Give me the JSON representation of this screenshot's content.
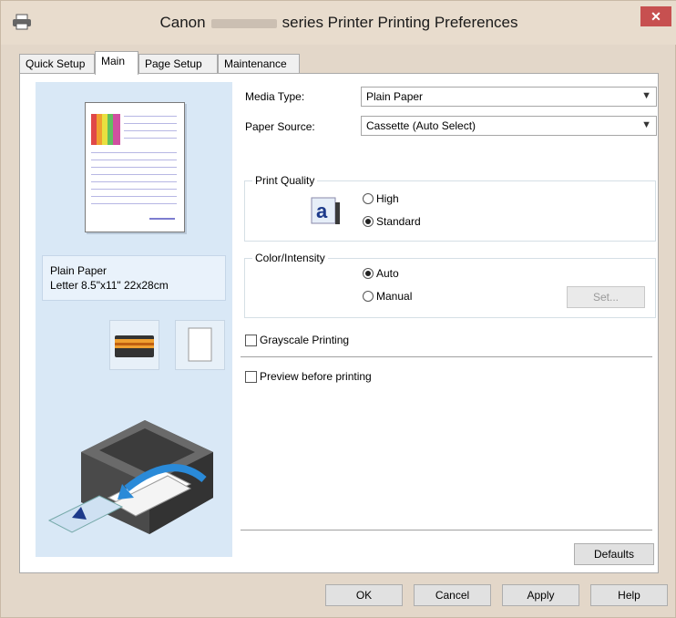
{
  "window": {
    "title_prefix": "Canon",
    "title_suffix": "series Printer Printing Preferences",
    "close_label": "✕"
  },
  "tabs": [
    {
      "label": "Quick Setup",
      "active": false
    },
    {
      "label": "Main",
      "active": true
    },
    {
      "label": "Page Setup",
      "active": false
    },
    {
      "label": "Maintenance",
      "active": false
    }
  ],
  "preview": {
    "paper_info_line1": "Plain Paper",
    "paper_info_line2": "Letter 8.5\"x11\" 22x28cm"
  },
  "main": {
    "media_type_label": "Media Type:",
    "media_type_value": "Plain Paper",
    "paper_source_label": "Paper Source:",
    "paper_source_value": "Cassette (Auto Select)",
    "print_quality": {
      "legend": "Print Quality",
      "options": [
        {
          "label": "High",
          "selected": false
        },
        {
          "label": "Standard",
          "selected": true
        }
      ]
    },
    "color_intensity": {
      "legend": "Color/Intensity",
      "options": [
        {
          "label": "Auto",
          "selected": true
        },
        {
          "label": "Manual",
          "selected": false
        }
      ],
      "set_button_label": "Set..."
    },
    "grayscale_label": "Grayscale Printing",
    "grayscale_checked": false,
    "preview_label": "Preview before printing",
    "preview_checked": false,
    "defaults_label": "Defaults"
  },
  "footer": {
    "ok_label": "OK",
    "cancel_label": "Cancel",
    "apply_label": "Apply",
    "help_label": "Help"
  },
  "colors": {
    "frame": "#e3d7c9",
    "left_panel": "#d9e8f6",
    "close": "#c75050"
  }
}
